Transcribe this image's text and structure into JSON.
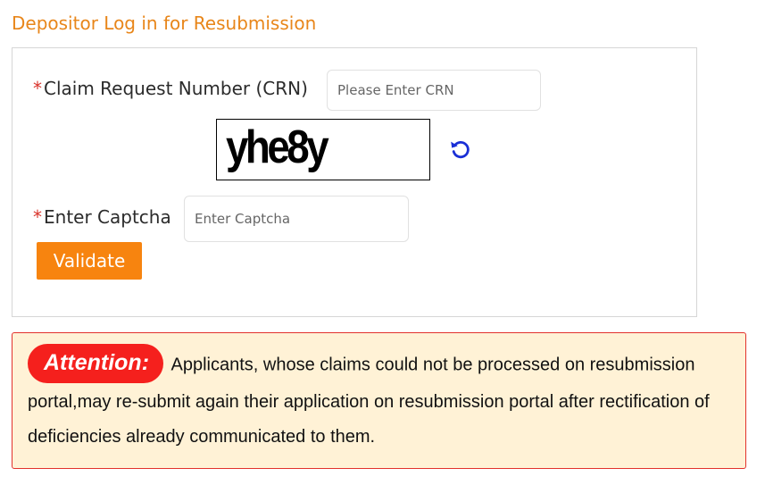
{
  "page": {
    "title": "Depositor Log in for Resubmission"
  },
  "form": {
    "crn_label": "Claim Request Number (CRN)",
    "crn_required": "*",
    "crn_placeholder": "Please Enter CRN",
    "crn_value": "",
    "captcha_image_text": "yhe8y",
    "refresh_icon": "refresh-icon",
    "captcha_label": "Enter Captcha",
    "captcha_required": "*",
    "captcha_placeholder": "Enter Captcha",
    "captcha_value": "",
    "validate_label": "Validate"
  },
  "notice": {
    "badge": "Attention:",
    "message": " Applicants, whose claims could not be processed on resubmission portal,may re-submit again their application on resubmission portal after rectification of deficiencies already communicated to them."
  },
  "colors": {
    "accent_orange": "#f7840f",
    "title_orange": "#e8861a",
    "required_red": "#d9342b",
    "badge_red": "#f5201d",
    "notice_background": "#fff2d6",
    "refresh_blue": "#1a2fd6"
  }
}
